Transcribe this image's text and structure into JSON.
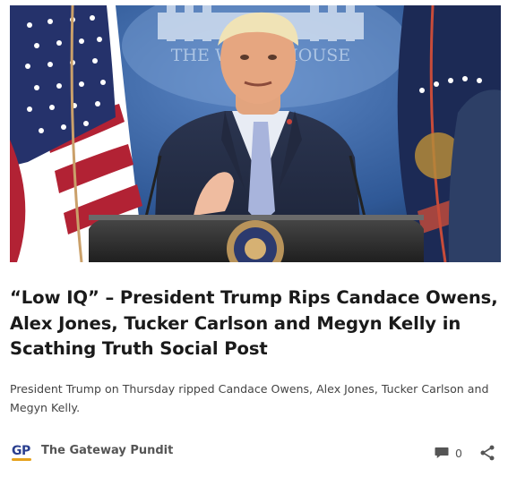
{
  "article": {
    "image_alt": "President Trump speaking at a podium in front of The White House backdrop and flags",
    "headline": "“Low IQ” – President Trump Rips Candace Owens, Alex Jones, Tucker Carlson and Megyn Kelly in Scathing Truth Social Post",
    "excerpt": "President Trump on Thursday ripped Candace Owens, Alex Jones, Tucker Carlson and Megyn Kelly."
  },
  "backdrop": {
    "seal_text": "THE WHITE HOUSE"
  },
  "byline": {
    "logo_text": "GP",
    "site_name": "The Gateway Pundit",
    "comment_count": "0"
  },
  "icons": {
    "comment": "comment-bubble-icon",
    "share": "share-icon"
  },
  "colors": {
    "logo_blue": "#2a3f8f",
    "logo_gold": "#e6a21c",
    "backdrop_blue": "#3a66a8"
  }
}
